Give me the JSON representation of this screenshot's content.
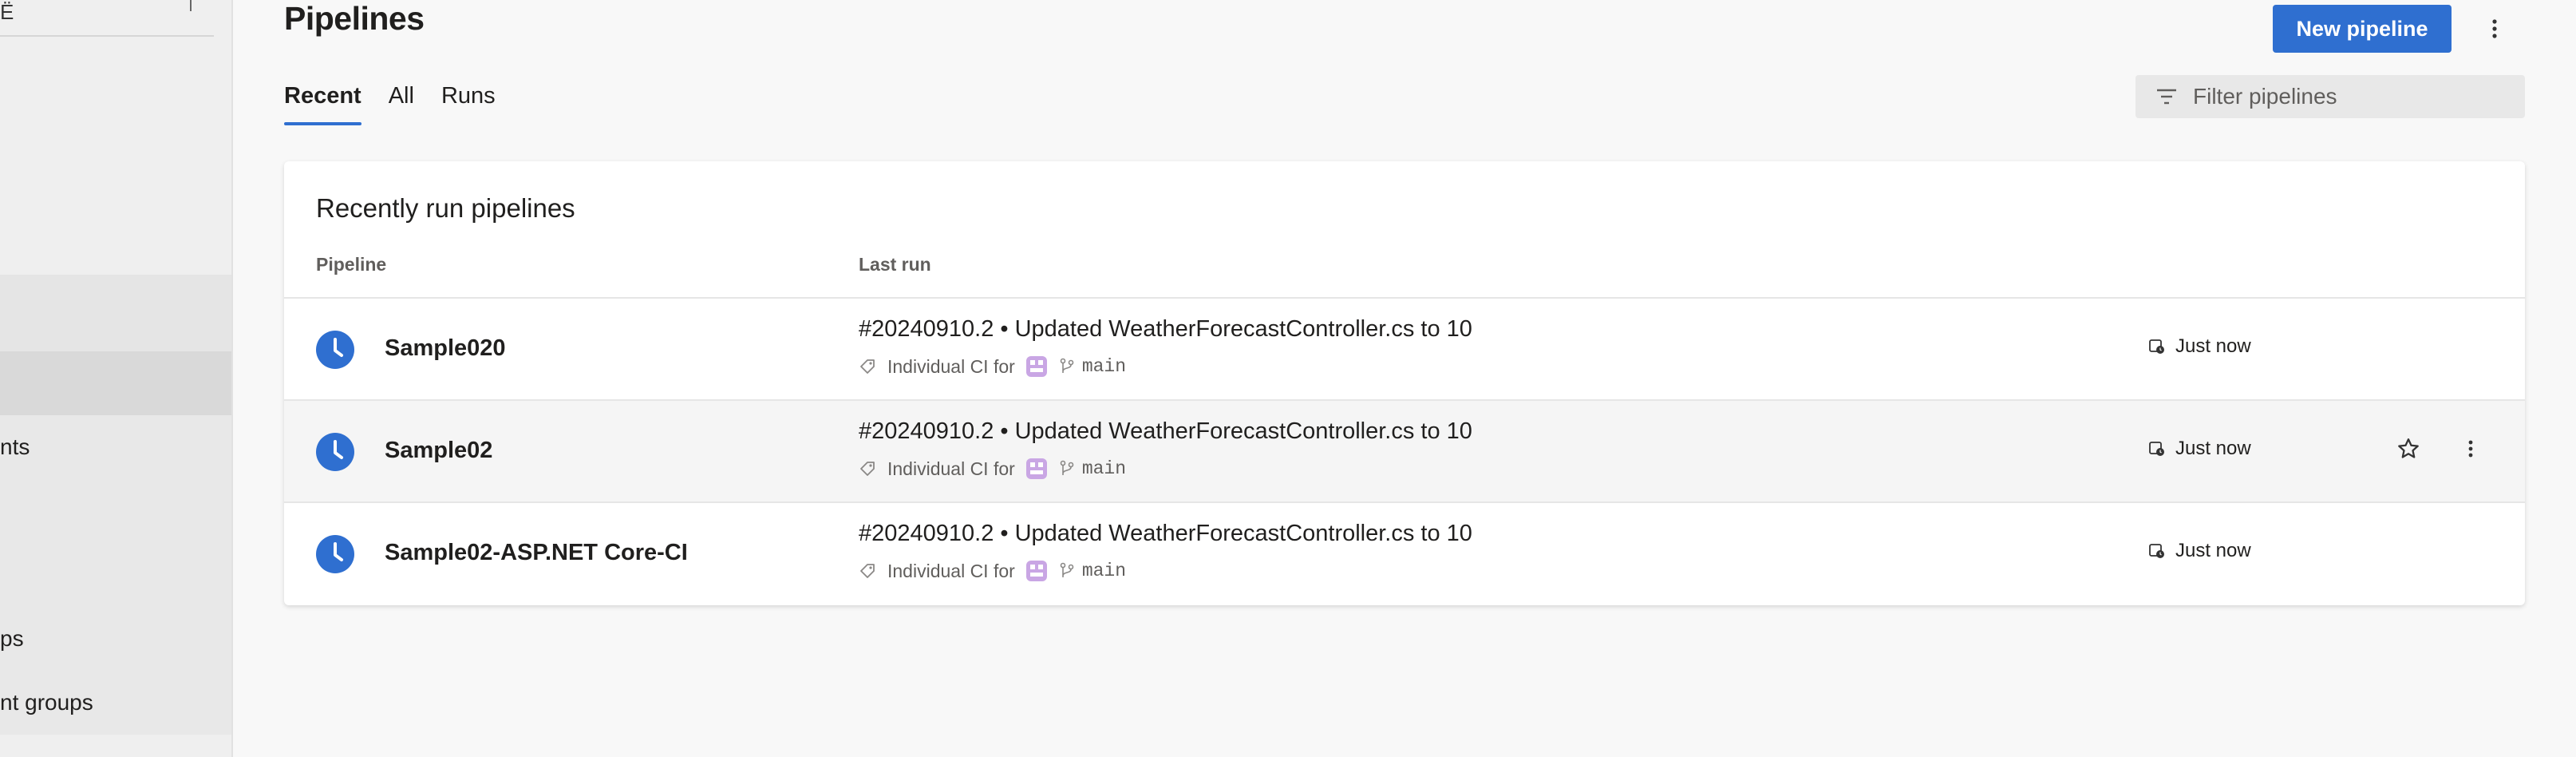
{
  "sidebar": {
    "top_char": "Ë",
    "items": [
      {
        "label": "nts"
      },
      {
        "label": "ps"
      },
      {
        "label": "nt groups"
      }
    ]
  },
  "header": {
    "title": "Pipelines",
    "new_button": "New pipeline",
    "more_icon": "more-vertical-icon"
  },
  "tabs": [
    {
      "label": "Recent",
      "active": true
    },
    {
      "label": "All",
      "active": false
    },
    {
      "label": "Runs",
      "active": false
    }
  ],
  "filter": {
    "placeholder": "Filter pipelines",
    "icon": "filter-icon"
  },
  "card": {
    "title": "Recently run pipelines",
    "columns": [
      "Pipeline",
      "Last run"
    ]
  },
  "pipelines": [
    {
      "name": "Sample020",
      "run": "#20240910.2 • Updated WeatherForecastController.cs to 10",
      "trigger": "Individual CI for",
      "branch": "main",
      "time": "Just now",
      "status": "queued"
    },
    {
      "name": "Sample02",
      "run": "#20240910.2 • Updated WeatherForecastController.cs to 10",
      "trigger": "Individual CI for",
      "branch": "main",
      "time": "Just now",
      "status": "queued"
    },
    {
      "name": "Sample02-ASP.NET Core-CI",
      "run": "#20240910.2 • Updated WeatherForecastController.cs to 10",
      "trigger": "Individual CI for",
      "branch": "main",
      "time": "Just now",
      "status": "queued"
    }
  ],
  "colors": {
    "accent": "#2f6fd0",
    "status_blue": "#2f6fd0",
    "avatar_purple": "#b388d6"
  }
}
